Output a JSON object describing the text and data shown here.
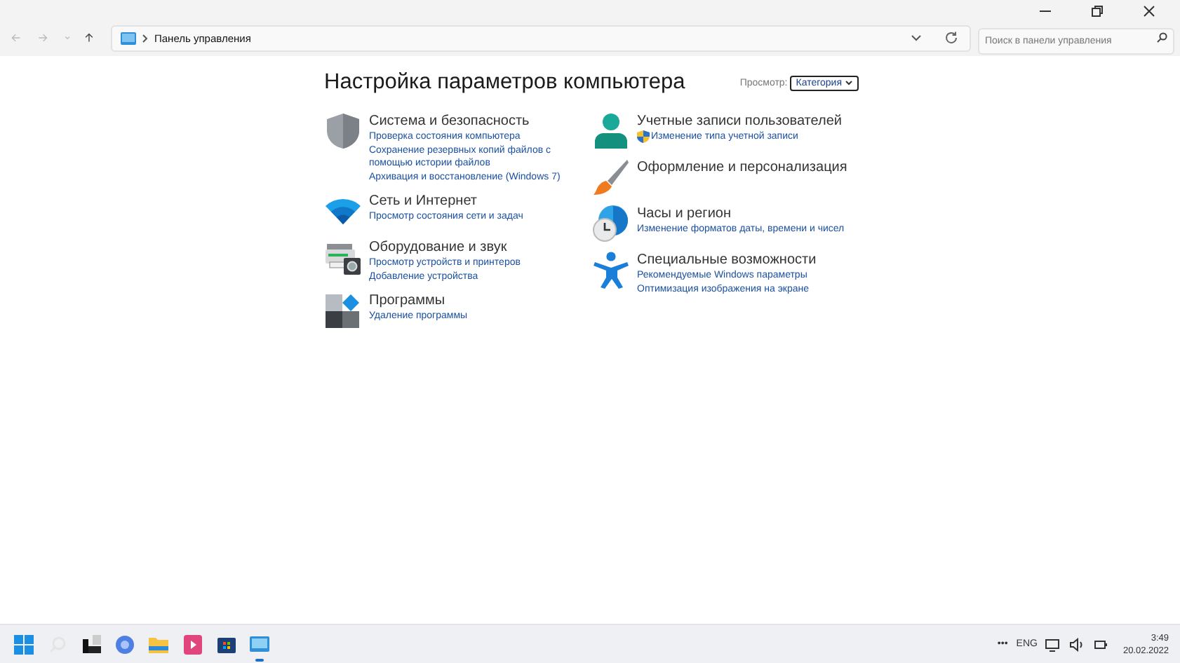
{
  "address_bar": {
    "path": "Панель управления",
    "search_placeholder": "Поиск в панели управления"
  },
  "page": {
    "title": "Настройка параметров компьютера",
    "view_label": "Просмотр:",
    "view_value": "Категория"
  },
  "left_column": [
    {
      "kind": "shield",
      "title": "Система и безопасность",
      "links": [
        {
          "text": "Проверка состояния компьютера",
          "uac": false
        },
        {
          "text": "Сохранение резервных копий файлов с помощью истории файлов",
          "uac": false
        },
        {
          "text": "Архивация и восстановление (Windows 7)",
          "uac": false
        }
      ]
    },
    {
      "kind": "wifi",
      "title": "Сеть и Интернет",
      "links": [
        {
          "text": "Просмотр состояния сети и задач",
          "uac": false
        }
      ]
    },
    {
      "kind": "printer",
      "title": "Оборудование и звук",
      "links": [
        {
          "text": "Просмотр устройств и принтеров",
          "uac": false
        },
        {
          "text": "Добавление устройства",
          "uac": false
        }
      ]
    },
    {
      "kind": "programs",
      "title": "Программы",
      "links": [
        {
          "text": "Удаление программы",
          "uac": false
        }
      ]
    }
  ],
  "right_column": [
    {
      "kind": "user",
      "title": "Учетные записи пользователей",
      "links": [
        {
          "text": "Изменение типа учетной записи",
          "uac": true
        }
      ]
    },
    {
      "kind": "brush",
      "title": "Оформление и персонализация"
    },
    {
      "kind": "clock",
      "title": "Часы и регион",
      "links": [
        {
          "text": "Изменение форматов даты, времени и чисел",
          "uac": false
        }
      ]
    },
    {
      "kind": "access",
      "title": "Специальные возможности",
      "links": [
        {
          "text": "Рекомендуемые Windows параметры",
          "uac": false
        },
        {
          "text": "Оптимизация изображения на экране",
          "uac": false
        }
      ]
    }
  ],
  "taskbar": {
    "apps": [
      {
        "kind": "start",
        "running": false
      },
      {
        "kind": "search",
        "running": false
      },
      {
        "kind": "widgets",
        "running": false
      },
      {
        "kind": "browser",
        "running": false
      },
      {
        "kind": "folder",
        "running": false
      },
      {
        "kind": "media",
        "running": false
      },
      {
        "kind": "store",
        "running": false
      },
      {
        "kind": "control",
        "running": true
      }
    ],
    "overflow": "•••",
    "language": "ENG",
    "time": "3:49",
    "date": "20.02.2022"
  }
}
